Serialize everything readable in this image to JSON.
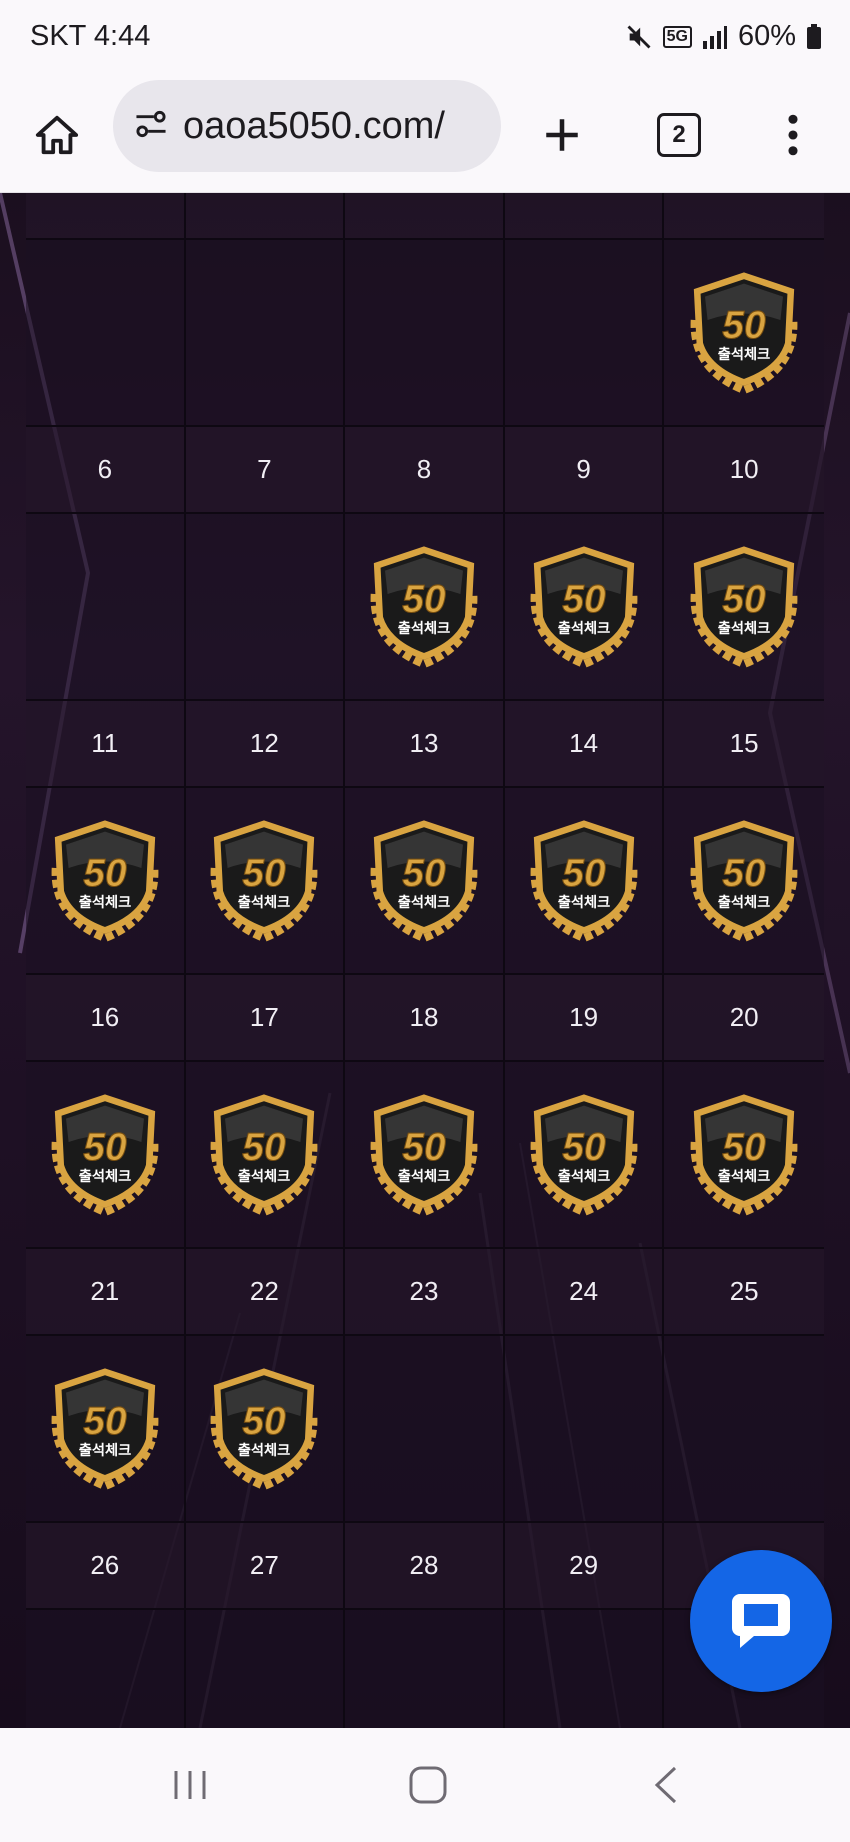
{
  "status": {
    "time": "SKT 4:44",
    "network": "5G",
    "battery": "60%"
  },
  "browser": {
    "url": "oaoa5050.com/",
    "tab_count": "2"
  },
  "calendar": {
    "badge": {
      "number": "50",
      "caption": "출석체크"
    },
    "weeks": [
      {
        "days": [
          "",
          "",
          "",
          "",
          ""
        ],
        "checked": [
          false,
          false,
          false,
          false,
          true
        ]
      },
      {
        "days": [
          "6",
          "7",
          "8",
          "9",
          "10"
        ],
        "checked": [
          false,
          false,
          true,
          true,
          true
        ]
      },
      {
        "days": [
          "11",
          "12",
          "13",
          "14",
          "15"
        ],
        "checked": [
          true,
          true,
          true,
          true,
          true
        ]
      },
      {
        "days": [
          "16",
          "17",
          "18",
          "19",
          "20"
        ],
        "checked": [
          true,
          true,
          true,
          true,
          true
        ]
      },
      {
        "days": [
          "21",
          "22",
          "23",
          "24",
          "25"
        ],
        "checked": [
          true,
          true,
          false,
          false,
          false
        ]
      },
      {
        "days": [
          "26",
          "27",
          "28",
          "29",
          ""
        ],
        "checked": [
          false,
          false,
          false,
          false,
          false
        ]
      }
    ]
  },
  "colors": {
    "chat_fab": "#1466e6",
    "top_fab": "#7a1fa8",
    "badge_gold": "#d9a441"
  }
}
